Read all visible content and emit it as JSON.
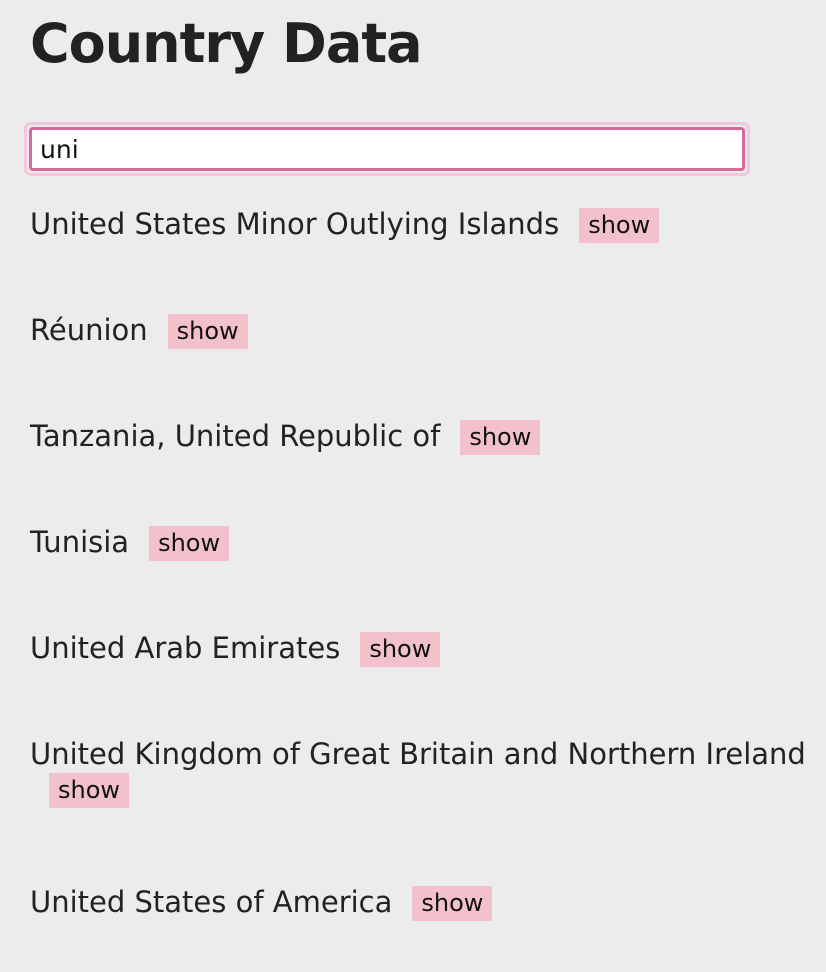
{
  "page": {
    "title": "Country Data"
  },
  "search": {
    "value": "uni",
    "placeholder": ""
  },
  "results": [
    {
      "name": "United States Minor Outlying Islands",
      "action_label": "show"
    },
    {
      "name": "Réunion",
      "action_label": "show"
    },
    {
      "name": "Tanzania, United Republic of",
      "action_label": "show"
    },
    {
      "name": "Tunisia",
      "action_label": "show"
    },
    {
      "name": "United Arab Emirates",
      "action_label": "show"
    },
    {
      "name": "United Kingdom of Great Britain and Northern Ireland",
      "action_label": "show"
    },
    {
      "name": "United States of America",
      "action_label": "show"
    }
  ],
  "colors": {
    "background": "#ececec",
    "focus_border": "#d9679a",
    "focus_ring": "#f1c8dc",
    "button_bg": "#f3c1cc"
  }
}
